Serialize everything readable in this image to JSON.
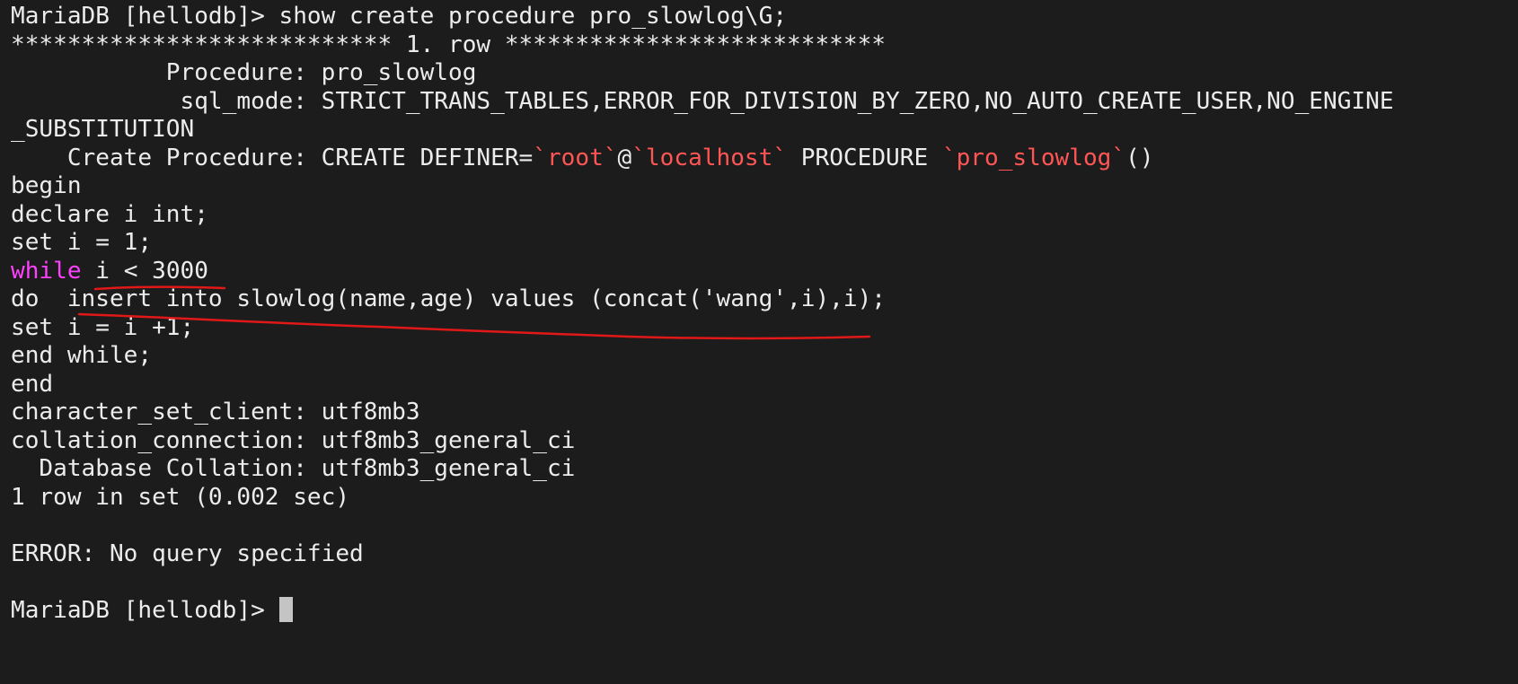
{
  "colors": {
    "background": "#1c1c1c",
    "text": "#ececec",
    "identifier": "#ff5555",
    "keyword": "#ff40ff",
    "annotation": "#e01818"
  },
  "terminal": {
    "lines": [
      [
        {
          "t": "MariaDB [hellodb]> show create procedure pro_slowlog\\G;"
        }
      ],
      [
        {
          "t": "*************************** 1. row ***************************"
        }
      ],
      [
        {
          "t": "           Procedure: pro_slowlog"
        }
      ],
      [
        {
          "t": "            sql_mode: STRICT_TRANS_TABLES,ERROR_FOR_DIVISION_BY_ZERO,NO_AUTO_CREATE_USER,NO_ENGINE"
        }
      ],
      [
        {
          "t": "_SUBSTITUTION"
        }
      ],
      [
        {
          "t": "    Create Procedure: CREATE DEFINER="
        },
        {
          "t": "`root`",
          "c": "identifier"
        },
        {
          "t": "@"
        },
        {
          "t": "`localhost`",
          "c": "identifier"
        },
        {
          "t": " PROCEDURE "
        },
        {
          "t": "`pro_slowlog`",
          "c": "identifier"
        },
        {
          "t": "()"
        }
      ],
      [
        {
          "t": "begin"
        }
      ],
      [
        {
          "t": "declare i int;"
        }
      ],
      [
        {
          "t": "set i = 1;"
        }
      ],
      [
        {
          "t": "while",
          "c": "keyword"
        },
        {
          "t": " i < 3000"
        }
      ],
      [
        {
          "t": "do  insert into slowlog(name,age) values (concat('wang',i),i);"
        }
      ],
      [
        {
          "t": "set i = i +1;"
        }
      ],
      [
        {
          "t": "end while;"
        }
      ],
      [
        {
          "t": "end"
        }
      ],
      [
        {
          "t": "character_set_client: utf8mb3"
        }
      ],
      [
        {
          "t": "collation_connection: utf8mb3_general_ci"
        }
      ],
      [
        {
          "t": "  Database Collation: utf8mb3_general_ci"
        }
      ],
      [
        {
          "t": "1 row in set (0.002 sec)"
        }
      ],
      [],
      [
        {
          "t": "ERROR: No query specified"
        }
      ],
      [],
      [
        {
          "t": "MariaDB [hellodb]> "
        }
      ]
    ]
  }
}
